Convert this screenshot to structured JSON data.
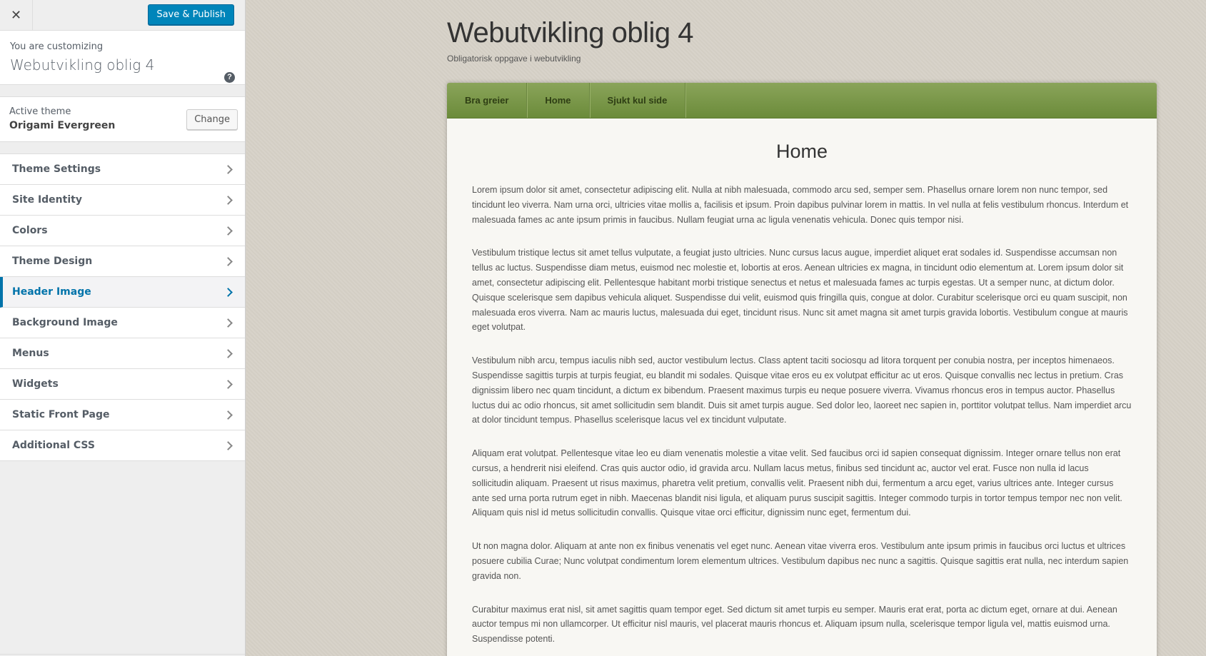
{
  "sidebar": {
    "close_icon": "close-icon",
    "save_label": "Save & Publish",
    "customizing_label": "You are customizing",
    "site_title": "Webutvikling oblig 4",
    "help_icon": "?",
    "active_theme_label": "Active theme",
    "theme_name": "Origami Evergreen",
    "change_label": "Change",
    "panels": [
      {
        "label": "Theme Settings"
      },
      {
        "label": "Site Identity"
      },
      {
        "label": "Colors"
      },
      {
        "label": "Theme Design"
      },
      {
        "label": "Header Image",
        "active": true
      },
      {
        "label": "Background Image"
      },
      {
        "label": "Menus"
      },
      {
        "label": "Widgets"
      },
      {
        "label": "Static Front Page"
      },
      {
        "label": "Additional CSS"
      }
    ],
    "accent_color": "#0073aa",
    "save_color": "#0085ba"
  },
  "preview": {
    "site_title": "Webutvikling oblig 4",
    "tagline": "Obligatorisk oppgave i webutvikling",
    "nav": [
      "Bra greier",
      "Home",
      "Sjukt kul side"
    ],
    "nav_color": "#7a9a48",
    "page_title": "Home",
    "paragraphs": [
      "Lorem ipsum dolor sit amet, consectetur adipiscing elit. Nulla at nibh malesuada, commodo arcu sed, semper sem. Phasellus ornare lorem non nunc tempor, sed tincidunt leo viverra. Nam urna orci, ultricies vitae mollis a, facilisis et ipsum. Proin dapibus pulvinar lorem in mattis. In vel nulla at felis vestibulum rhoncus. Interdum et malesuada fames ac ante ipsum primis in faucibus. Nullam feugiat urna ac ligula venenatis vehicula. Donec quis tempor nisi.",
      "Vestibulum tristique lectus sit amet tellus vulputate, a feugiat justo ultricies. Nunc cursus lacus augue, imperdiet aliquet erat sodales id. Suspendisse accumsan non tellus ac luctus. Suspendisse diam metus, euismod nec molestie et, lobortis at eros. Aenean ultricies ex magna, in tincidunt odio elementum at. Lorem ipsum dolor sit amet, consectetur adipiscing elit. Pellentesque habitant morbi tristique senectus et netus et malesuada fames ac turpis egestas. Ut a semper nunc, at dictum dolor. Quisque scelerisque sem dapibus vehicula aliquet. Suspendisse dui velit, euismod quis fringilla quis, congue at dolor. Curabitur scelerisque orci eu quam suscipit, non malesuada eros viverra. Nam ac mauris luctus, malesuada dui eget, tincidunt risus. Nunc sit amet magna sit amet turpis gravida lobortis. Vestibulum congue at mauris eget volutpat.",
      "Vestibulum nibh arcu, tempus iaculis nibh sed, auctor vestibulum lectus. Class aptent taciti sociosqu ad litora torquent per conubia nostra, per inceptos himenaeos. Suspendisse sagittis turpis at turpis feugiat, eu blandit mi sodales. Quisque vitae eros eu ex volutpat efficitur ac ut eros. Quisque convallis nec lectus in pretium. Cras dignissim libero nec quam tincidunt, a dictum ex bibendum. Praesent maximus turpis eu neque posuere viverra. Vivamus rhoncus eros in tempus auctor. Phasellus luctus dui ac odio rhoncus, sit amet sollicitudin sem blandit. Duis sit amet turpis augue. Sed dolor leo, laoreet nec sapien in, porttitor volutpat tellus. Nam imperdiet arcu at dolor tincidunt tempus. Phasellus scelerisque lacus vel ex tincidunt vulputate.",
      "Aliquam erat volutpat. Pellentesque vitae leo eu diam venenatis molestie a vitae velit. Sed faucibus orci id sapien consequat dignissim. Integer ornare tellus non erat cursus, a hendrerit nisi eleifend. Cras quis auctor odio, id gravida arcu. Nullam lacus metus, finibus sed tincidunt ac, auctor vel erat. Fusce non nulla id lacus sollicitudin aliquam. Praesent ut risus maximus, pharetra velit pretium, convallis velit. Praesent nibh dui, fermentum a arcu eget, varius ultrices ante. Integer cursus ante sed urna porta rutrum eget in nibh. Maecenas blandit nisi ligula, et aliquam purus suscipit sagittis. Integer commodo turpis in tortor tempus tempor nec non velit. Aliquam quis nisl id metus sollicitudin convallis. Quisque vitae orci efficitur, dignissim nunc eget, fermentum dui.",
      "Ut non magna dolor. Aliquam at ante non ex finibus venenatis vel eget nunc. Aenean vitae viverra eros. Vestibulum ante ipsum primis in faucibus orci luctus et ultrices posuere cubilia Curae; Nunc volutpat condimentum lorem elementum ultrices. Vestibulum dapibus nec nunc a sagittis. Quisque sagittis erat nulla, nec interdum sapien gravida non.",
      "Curabitur maximus erat nisl, sit amet sagittis quam tempor eget. Sed dictum sit amet turpis eu semper. Mauris erat erat, porta ac dictum eget, ornare at dui. Aenean auctor tempus mi non ullamcorper. Ut efficitur nisl mauris, vel placerat mauris rhoncus et. Aliquam ipsum nulla, scelerisque tempor ligula vel, mattis euismod urna. Suspendisse potenti."
    ]
  }
}
